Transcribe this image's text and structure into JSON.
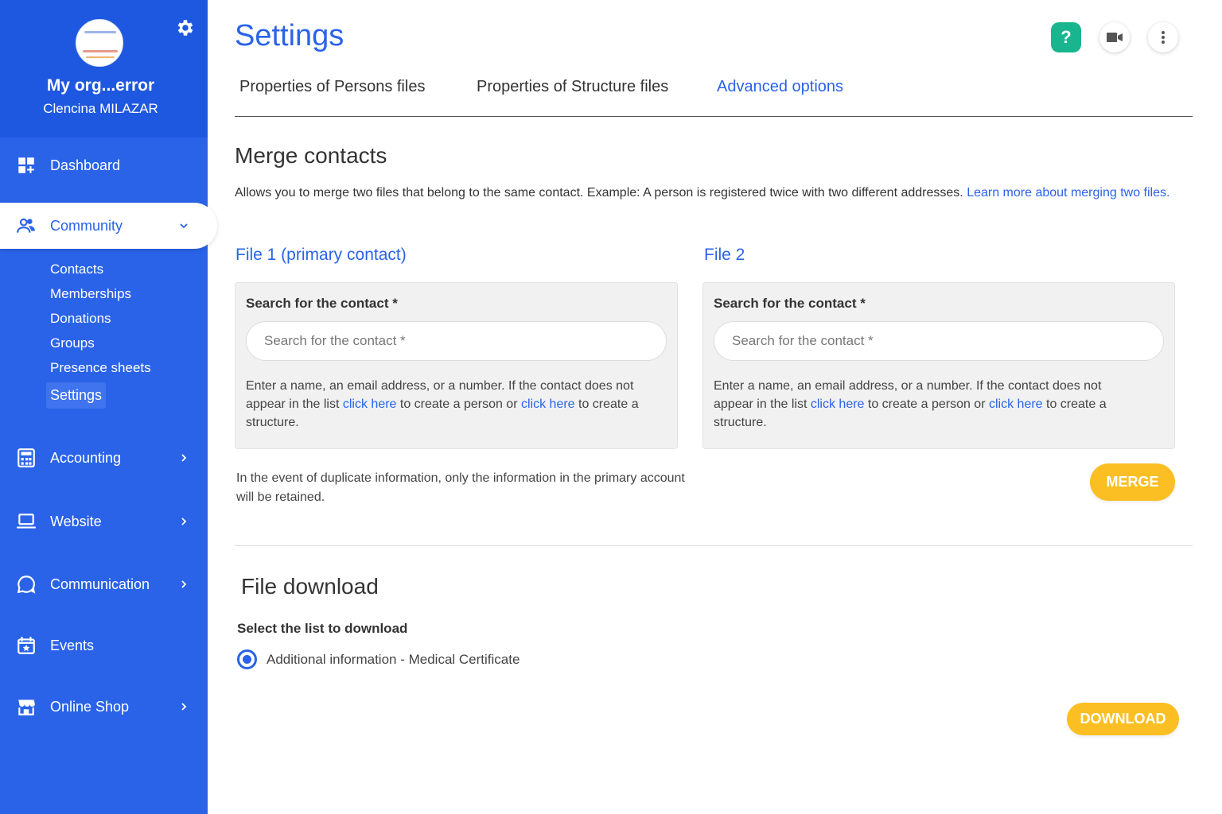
{
  "sidebar": {
    "org_name": "My org...error",
    "user_name": "Clencina MILAZAR",
    "items": {
      "dashboard": "Dashboard",
      "community": "Community",
      "accounting": "Accounting",
      "website": "Website",
      "communication": "Communication",
      "events": "Events",
      "online_shop": "Online Shop"
    },
    "community_sub": {
      "contacts": "Contacts",
      "memberships": "Memberships",
      "donations": "Donations",
      "groups": "Groups",
      "presence_sheets": "Presence sheets",
      "settings": "Settings"
    }
  },
  "header": {
    "title": "Settings",
    "help_label": "?"
  },
  "tabs": {
    "persons": "Properties of Persons files",
    "structure": "Properties of Structure files",
    "advanced": "Advanced options"
  },
  "merge": {
    "title": "Merge contacts",
    "description": "Allows you to merge two files that belong to the same contact. Example: A person is registered twice with two different addresses.",
    "learn_more": "Learn more about merging two files.",
    "file1_title": "File 1 (primary contact)",
    "file2_title": "File 2",
    "search_label": "Search for the contact *",
    "search_placeholder": "Search for the contact *",
    "help_part1": "Enter a name, an email address, or a number. If the contact does not appear in the list",
    "click_here": "click here",
    "help_part2": "to create a person or",
    "help_part3": "to create a structure.",
    "note": "In the event of duplicate information, only the information in the primary account will be retained.",
    "merge_button": "MERGE"
  },
  "download": {
    "title": "File download",
    "select_label": "Select the list to download",
    "option": "Additional information - Medical Certificate",
    "download_button": "DOWNLOAD"
  },
  "colors": {
    "primary": "#2a63e8",
    "sidebar": "#2a63e8",
    "accent_yellow": "#fbbf24",
    "help_green": "#19b58f"
  }
}
